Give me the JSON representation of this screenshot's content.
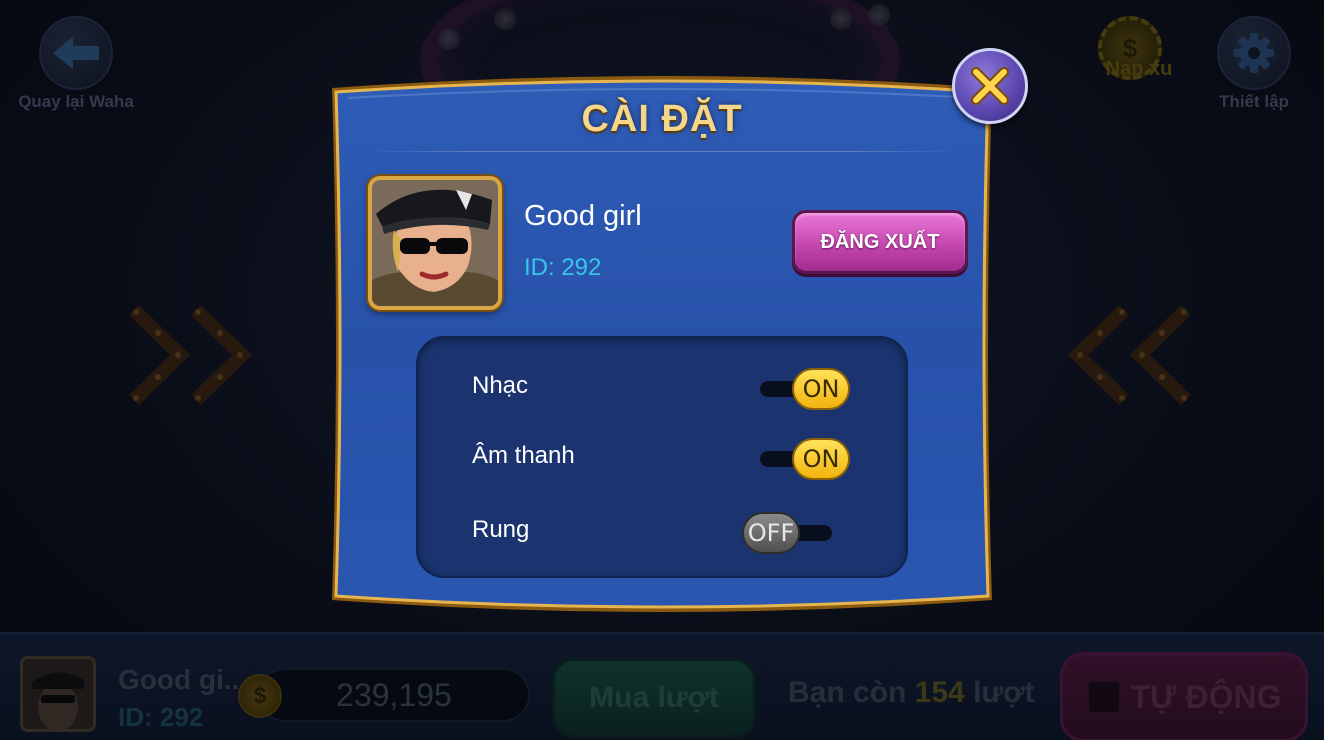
{
  "background": {
    "back_button": {
      "label": "Quay lại Waha",
      "icon": "arrow-left-icon"
    },
    "topup_button": {
      "label": "Nạp xu",
      "icon": "coin-icon",
      "symbol": "$"
    },
    "settings_button": {
      "label": "Thiết lập",
      "icon": "gear-icon"
    },
    "bottom_bar": {
      "player_name": "Good gi...",
      "player_id": "ID: 292",
      "coin_symbol": "$",
      "balance": "239,195",
      "buy_button": "Mua lượt",
      "remaining_prefix": "Bạn còn ",
      "remaining_count": "154",
      "remaining_suffix": " lượt",
      "auto_button": "TỰ ĐỘNG"
    }
  },
  "modal": {
    "title": "CÀI ĐẶT",
    "close_icon": "close-icon",
    "user": {
      "name": "Good girl",
      "id": "ID: 292"
    },
    "logout_button": "ĐĂNG XUẤT",
    "settings": [
      {
        "label": "Nhạc",
        "state": "ON"
      },
      {
        "label": "Âm thanh",
        "state": "ON"
      },
      {
        "label": "Rung",
        "state": "OFF"
      }
    ]
  },
  "colors": {
    "modal_blue": "#2b57b0",
    "gold_border": "#d9a645",
    "title_gold": "#f6d68a",
    "logout_pink": "#c547ae",
    "toggle_on": "#f2b40e",
    "toggle_off": "#4f4f4f",
    "id_cyan": "#37c6e8"
  }
}
